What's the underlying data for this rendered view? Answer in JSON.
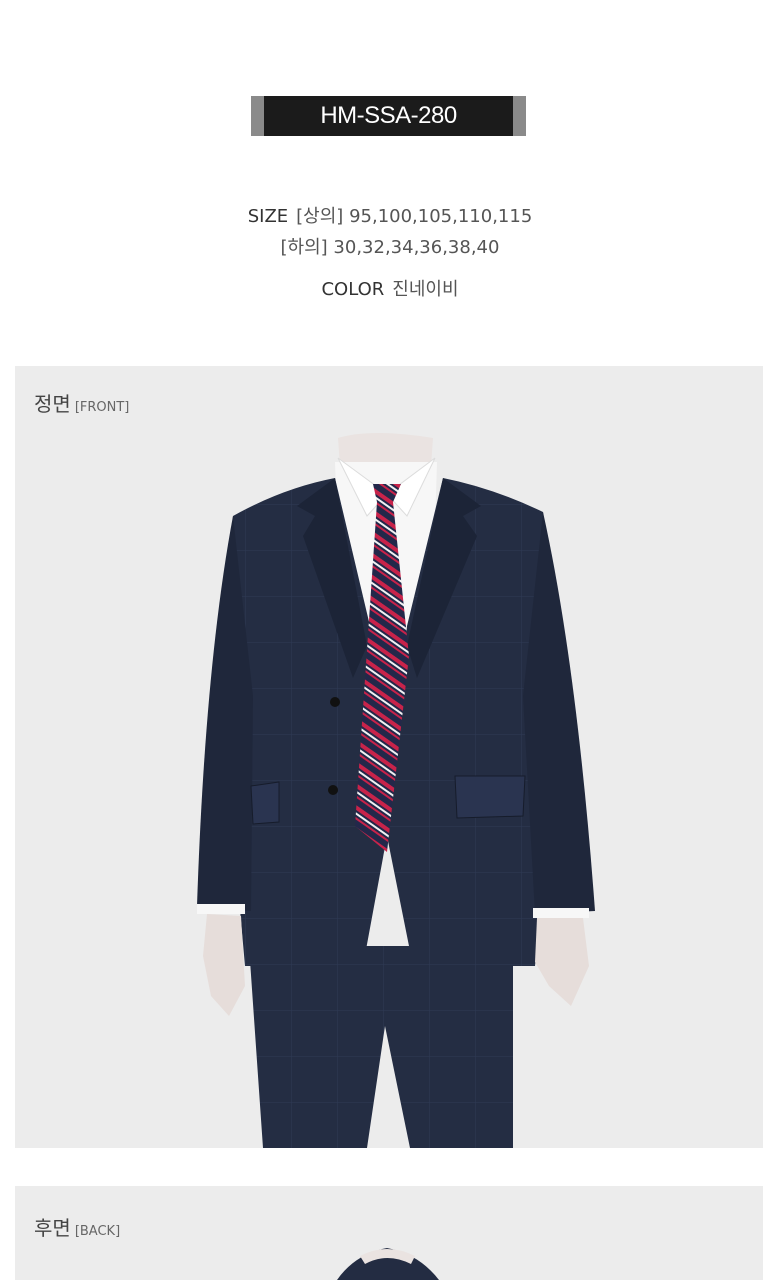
{
  "product": {
    "model_code": "HM-SSA-280",
    "size_label": "SIZE",
    "top_label": "[상의]",
    "top_sizes": "95,100,105,110,115",
    "bottom_label": "[하의]",
    "bottom_sizes": "30,32,34,36,38,40",
    "color_label": "COLOR",
    "color_value": "진네이비"
  },
  "sections": {
    "front": {
      "title": "정면",
      "subtitle": "[FRONT]"
    },
    "back": {
      "title": "후면",
      "subtitle": "[BACK]"
    }
  },
  "colors": {
    "suit": "#232c42",
    "tie_stripe": "#c8234a",
    "panel_bg": "#ececec",
    "badge_bg": "#1b1b1b"
  }
}
